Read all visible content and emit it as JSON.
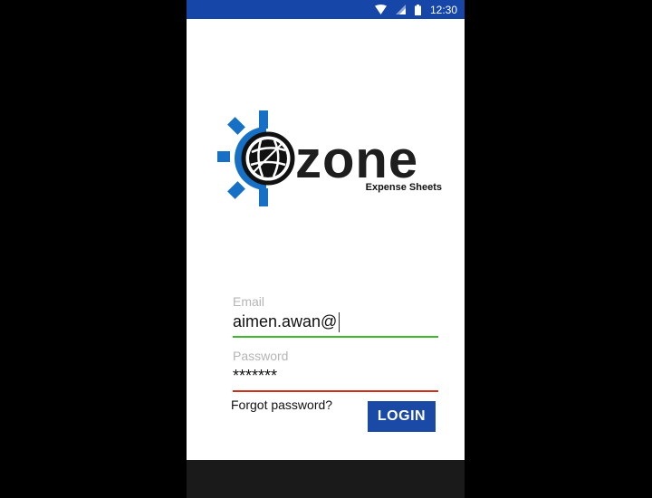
{
  "status_bar": {
    "time": "12:30",
    "icons": [
      "wifi-icon",
      "signal-icon",
      "battery-icon"
    ]
  },
  "logo": {
    "brand": "zone",
    "tagline": "Expense Sheets"
  },
  "form": {
    "email": {
      "label": "Email",
      "value": "aimen.awan@"
    },
    "password": {
      "label": "Password",
      "value": "*******"
    },
    "forgot_label": "Forgot password?",
    "login_label": "LOGIN"
  },
  "colors": {
    "status_bar": "#1646a8",
    "accent_blue": "#1a49a6",
    "logo_blue": "#1570c6",
    "valid_line": "#3cba2c",
    "error_line": "#d0301a"
  }
}
